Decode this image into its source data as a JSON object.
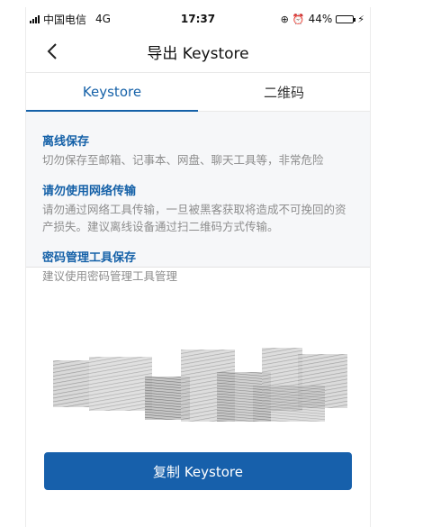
{
  "status_bar": {
    "carrier": "中国电信",
    "network": "4G",
    "time": "17:37",
    "battery_percent": "44%",
    "battery_level": 0.44
  },
  "nav": {
    "title": "导出 Keystore"
  },
  "tabs": [
    {
      "label": "Keystore",
      "active": true
    },
    {
      "label": "二维码",
      "active": false
    }
  ],
  "tips": [
    {
      "title": "离线保存",
      "body": "切勿保存至邮箱、记事本、网盘、聊天工具等，非常危险"
    },
    {
      "title": "请勿使用网络传输",
      "body": "请勿通过网络工具传输，一旦被黑客获取将造成不可挽回的资产损失。建议离线设备通过扫二维码方式传输。"
    },
    {
      "title": "密码管理工具保存",
      "body": "建议使用密码管理工具管理"
    }
  ],
  "copy_button": {
    "label": "复制 Keystore"
  },
  "colors": {
    "accent": "#1561a8",
    "button": "#1760ab",
    "tips_bg": "#f6f7f9",
    "battery": "#3cc13b"
  }
}
